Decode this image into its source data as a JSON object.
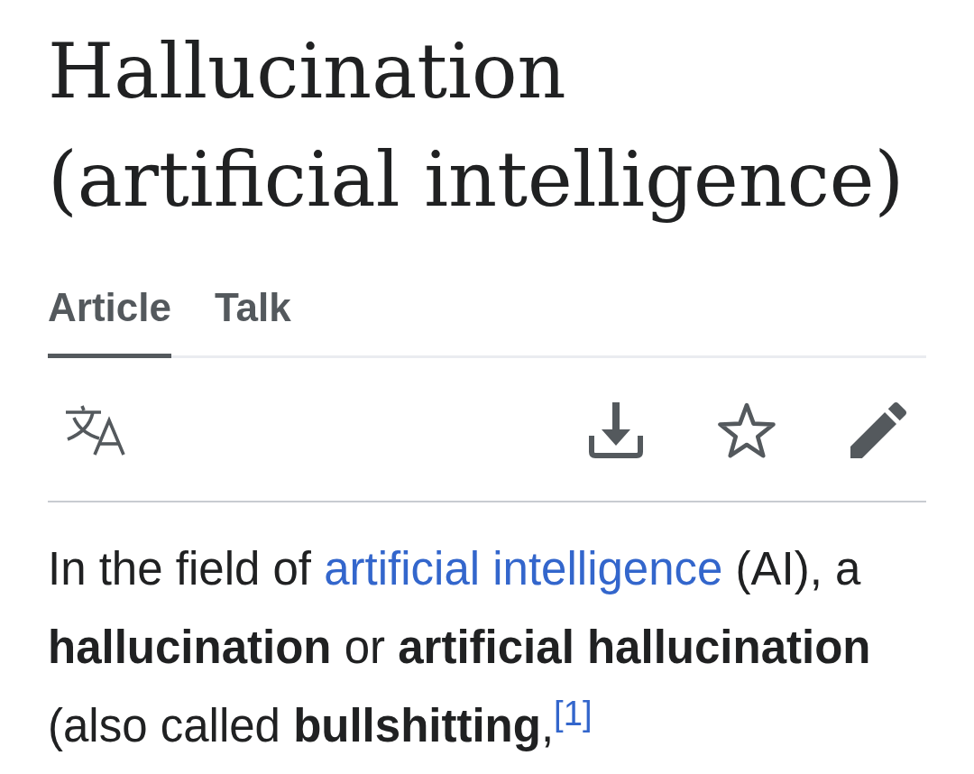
{
  "page_title": "Hallucination (artificial intelligence)",
  "tabs": [
    {
      "label": "Article",
      "selected": true
    },
    {
      "label": "Talk",
      "selected": false
    }
  ],
  "intro": [
    {
      "kind": "text",
      "text": "In the field of "
    },
    {
      "kind": "link",
      "text": "artificial intelligence"
    },
    {
      "kind": "text",
      "text": " (AI), a **hallucination** or **artificial hallucination** (also called **bullshitting**,"
    },
    {
      "kind": "footnote",
      "text": "[1]"
    }
  ]
}
